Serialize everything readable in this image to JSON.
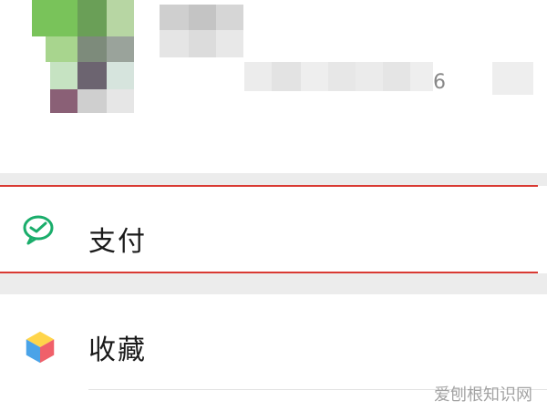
{
  "profile": {
    "id_suffix": "6"
  },
  "menu": {
    "items": [
      {
        "label": "支付",
        "icon": "wechat-pay-icon"
      },
      {
        "label": "收藏",
        "icon": "favorites-cube-icon"
      }
    ]
  },
  "watermark": {
    "text": "爱刨根知识网"
  },
  "colors": {
    "highlight": "#d93a33",
    "pay_icon": "#1aad6b"
  }
}
